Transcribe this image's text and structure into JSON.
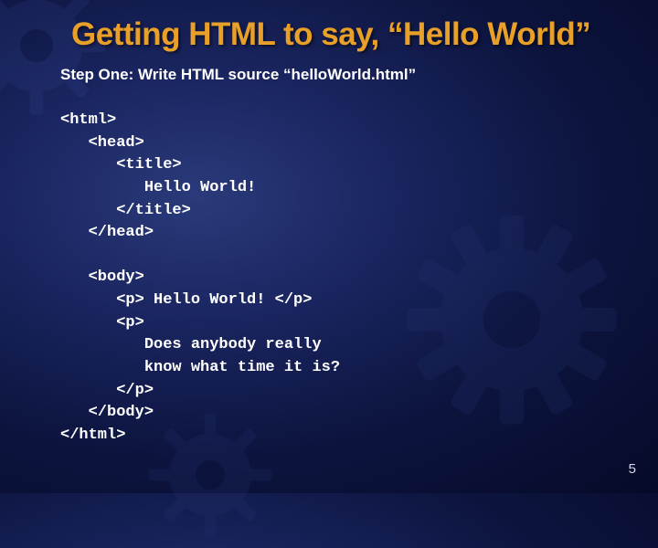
{
  "title": "Getting HTML to say, “Hello World”",
  "subtitle": "Step One: Write HTML source “helloWorld.html”",
  "code": "<html>\n   <head>\n      <title>\n         Hello World!\n      </title>\n   </head>\n\n   <body>\n      <p> Hello World! </p>\n      <p>\n         Does anybody really\n         know what time it is?\n      </p>\n   </body>\n</html>",
  "page_number": "5"
}
